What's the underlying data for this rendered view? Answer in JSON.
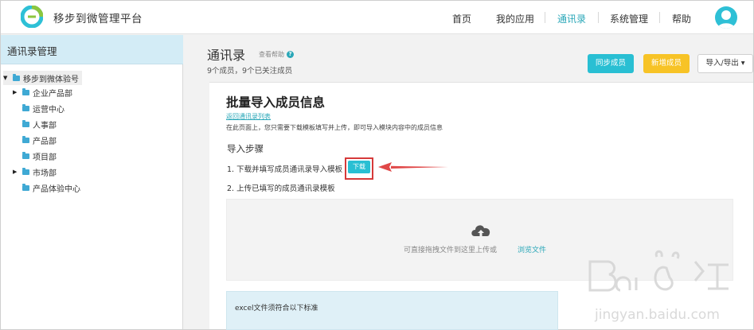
{
  "app": {
    "title": "移步到微管理平台"
  },
  "nav": {
    "items": [
      {
        "label": "首页",
        "active": false
      },
      {
        "label": "我的应用",
        "active": false
      },
      {
        "label": "通讯录",
        "active": true
      },
      {
        "label": "系统管理",
        "active": false
      },
      {
        "label": "帮助",
        "active": false
      }
    ]
  },
  "sidebar": {
    "title": "通讯录管理",
    "tree": [
      {
        "label": "移步到微体验号",
        "level": 0,
        "expandable": true,
        "expanded": true,
        "selected": true
      },
      {
        "label": "企业产品部",
        "level": 1,
        "expandable": true,
        "expanded": false
      },
      {
        "label": "运营中心",
        "level": 1,
        "expandable": false
      },
      {
        "label": "人事部",
        "level": 1,
        "expandable": false
      },
      {
        "label": "产品部",
        "level": 1,
        "expandable": false
      },
      {
        "label": "项目部",
        "level": 1,
        "expandable": false
      },
      {
        "label": "市场部",
        "level": 1,
        "expandable": true,
        "expanded": false
      },
      {
        "label": "产品体验中心",
        "level": 1,
        "expandable": false
      }
    ]
  },
  "main": {
    "title": "通讯录",
    "help_label": "查看帮助",
    "member_count": "9个成员，9个已关注成员",
    "buttons": {
      "sync": "同步成员",
      "add": "新增成员",
      "import_export": "导入/导出 ▾"
    }
  },
  "import": {
    "title": "批量导入成员信息",
    "back_link": "返回通讯录列表",
    "description": "在此页面上，您只需要下载模板填写并上传，即可导入模块内容中的成员信息",
    "steps_title": "导入步骤",
    "step1": "1. 下载并填写成员通讯录导入模板",
    "download_label": "下载",
    "step2": "2. 上传已填写的成员通讯录模板",
    "drop_text": "可直接拖拽文件到这里上传或",
    "browse_label": "浏览文件",
    "notice": "excel文件须符合以下标准"
  },
  "colors": {
    "accent": "#29bfd3",
    "warning": "#f7c326",
    "highlight_red": "#d63a3a",
    "sidebar_header": "#d3ecf6"
  },
  "icons": [
    "app-logo-icon",
    "avatar-icon",
    "folder-icon",
    "caret-right-icon",
    "caret-down-icon",
    "help-icon",
    "cloud-upload-icon",
    "red-arrow-icon"
  ]
}
